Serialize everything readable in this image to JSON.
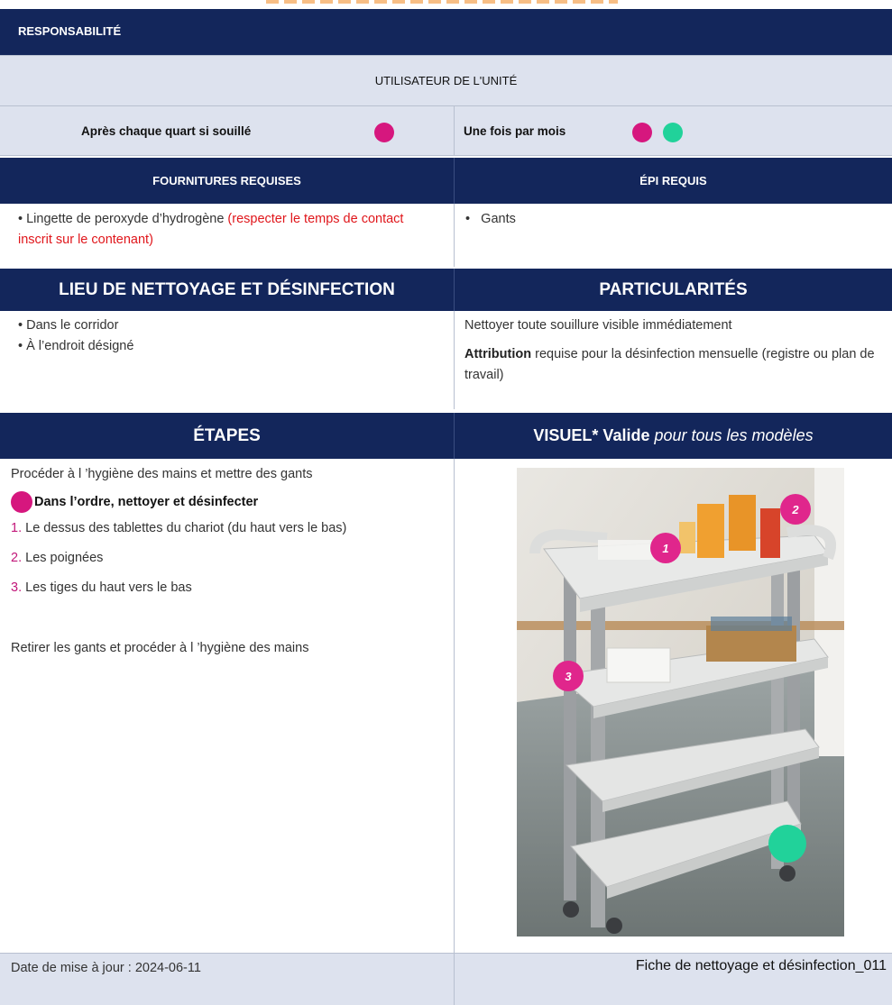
{
  "header": {
    "responsibility": "RESPONSABILITÉ",
    "user": "UTILISATEUR DE L'UNITÉ"
  },
  "frequency": {
    "left": "Après chaque quart si souillé",
    "right": "Une fois par mois"
  },
  "supplies": {
    "title": "FOURNITURES REQUISES",
    "item_prefix": "Lingette de peroxyde d’hydrogène",
    "item_note": "(respecter le temps de contact inscrit sur le contenant)"
  },
  "ppe": {
    "title": "ÉPI REQUIS",
    "item": "Gants"
  },
  "location": {
    "title": "LIEU DE NETTOYAGE ET DÉSINFECTION",
    "items": [
      "Dans le corridor",
      "À l’endroit désigné"
    ]
  },
  "particularities": {
    "title": "PARTICULARITÉS",
    "line1": "Nettoyer toute souillure visible immédiatement",
    "line2_bold": "Attribution",
    "line2_rest": "requise pour la désinfection mensuelle (registre ou plan de travail)"
  },
  "steps": {
    "title": "ÉTAPES",
    "intro": "Procéder à l ’hygiène des mains et mettre des gants",
    "order_heading": "Dans l’ordre, nettoyer et désinfecter",
    "items": [
      {
        "num": "1.",
        "text": "Le dessus des tablettes du chariot (du haut vers le bas)"
      },
      {
        "num": "2.",
        "text": "Les poignées"
      },
      {
        "num": "3.",
        "text": "Les tiges du haut vers le bas"
      }
    ],
    "outro": "Retirer les gants et procéder à l ’hygiène des mains"
  },
  "visual": {
    "title_bold": "VISUEL* Valide",
    "title_italic": "pour tous les modèles",
    "markers": [
      "1",
      "2",
      "3"
    ]
  },
  "footer": {
    "date": "Date de mise à jour : 2024-06-11",
    "doc": "Fiche de nettoyage et désinfection_011"
  },
  "colors": {
    "navy": "#13265b",
    "lavender": "#dde2ee",
    "pink": "#d6177e",
    "teal": "#21d29a",
    "red": "#e0161b"
  }
}
